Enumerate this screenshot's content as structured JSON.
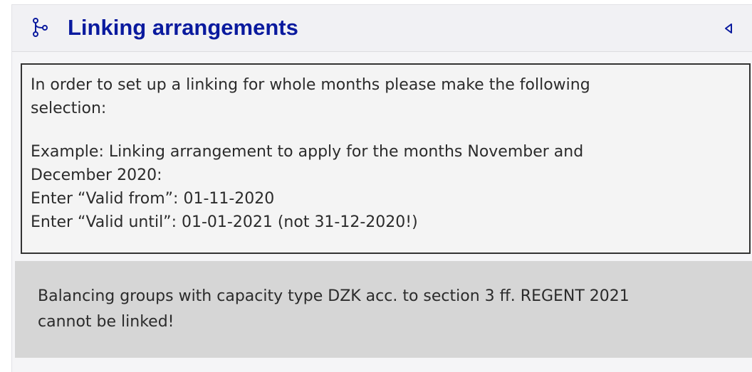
{
  "panel": {
    "title": "Linking arrangements",
    "header_icon": "branch-link-icon",
    "toggle_icon": "collapse-triangle-left-icon",
    "title_color": "#0a1a9e"
  },
  "info_box": {
    "lines": [
      "In order to set up a linking for whole months please make the following",
      "selection:",
      "Example: Linking arrangement to apply for the months November and",
      "December 2020:",
      "Enter “Valid from”: 01-11-2020",
      "Enter “Valid until”: 01-01-2021 (not 31-12-2020!)"
    ]
  },
  "warning_box": {
    "lines": [
      "Balancing groups with capacity type DZK acc. to section 3 ff. REGENT 2021",
      "cannot be linked!"
    ]
  }
}
